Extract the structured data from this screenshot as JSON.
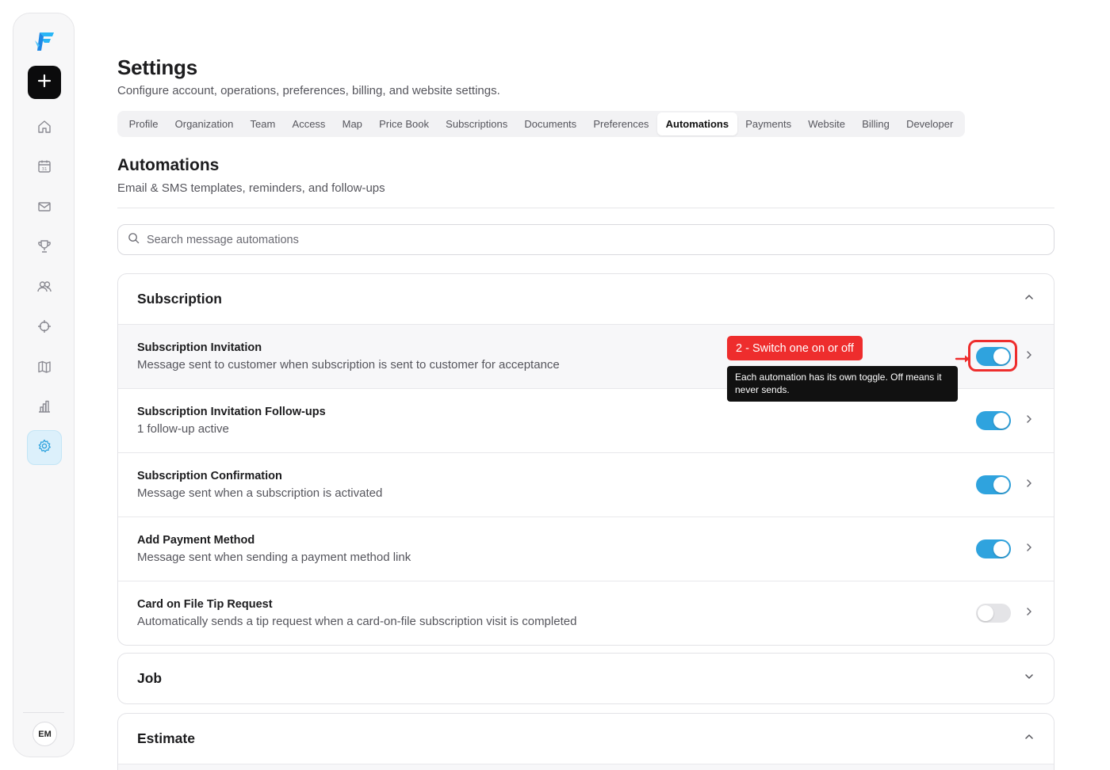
{
  "sidebar": {
    "logo_icon": "brand-logo",
    "new_button_icon": "plus-icon",
    "nav": [
      {
        "icon": "home-icon",
        "active": false
      },
      {
        "icon": "calendar-icon",
        "active": false
      },
      {
        "icon": "mail-icon",
        "active": false
      },
      {
        "icon": "trophy-icon",
        "active": false
      },
      {
        "icon": "users-icon",
        "active": false
      },
      {
        "icon": "target-icon",
        "active": false
      },
      {
        "icon": "map-icon",
        "active": false
      },
      {
        "icon": "bar-chart-icon",
        "active": false
      },
      {
        "icon": "gear-icon",
        "active": true
      }
    ],
    "avatar_initials": "EM"
  },
  "header": {
    "title": "Settings",
    "subtitle": "Configure account, operations, preferences, billing, and website settings."
  },
  "tabs": [
    {
      "label": "Profile",
      "active": false
    },
    {
      "label": "Organization",
      "active": false
    },
    {
      "label": "Team",
      "active": false
    },
    {
      "label": "Access",
      "active": false
    },
    {
      "label": "Map",
      "active": false
    },
    {
      "label": "Price Book",
      "active": false
    },
    {
      "label": "Subscriptions",
      "active": false
    },
    {
      "label": "Documents",
      "active": false
    },
    {
      "label": "Preferences",
      "active": false
    },
    {
      "label": "Automations",
      "active": true
    },
    {
      "label": "Payments",
      "active": false
    },
    {
      "label": "Website",
      "active": false
    },
    {
      "label": "Billing",
      "active": false
    },
    {
      "label": "Developer",
      "active": false
    }
  ],
  "section": {
    "title": "Automations",
    "subtitle": "Email & SMS templates, reminders, and follow-ups"
  },
  "search": {
    "placeholder": "Search message automations",
    "value": ""
  },
  "groups": [
    {
      "title": "Subscription",
      "expanded": true,
      "rows": [
        {
          "title": "Subscription Invitation",
          "desc": "Message sent to customer when subscription is sent to customer for acceptance",
          "enabled": true
        },
        {
          "title": "Subscription Invitation Follow-ups",
          "desc": "1 follow-up active",
          "enabled": true
        },
        {
          "title": "Subscription Confirmation",
          "desc": "Message sent when a subscription is activated",
          "enabled": true
        },
        {
          "title": "Add Payment Method",
          "desc": "Message sent when sending a payment method link",
          "enabled": true
        },
        {
          "title": "Card on File Tip Request",
          "desc": "Automatically sends a tip request when a card-on-file subscription visit is completed",
          "enabled": false
        }
      ]
    },
    {
      "title": "Job",
      "expanded": false,
      "rows": []
    },
    {
      "title": "Estimate",
      "expanded": true,
      "rows": []
    }
  ],
  "annotation": {
    "callout": "2 - Switch one on or off",
    "tooltip": "Each automation has its own toggle. Off means it never sends.",
    "color": "#ee2d2d"
  },
  "colors": {
    "toggle_on": "#2fa3de",
    "toggle_off": "#e4e4e7",
    "active_nav_bg": "#dcf0fb"
  }
}
